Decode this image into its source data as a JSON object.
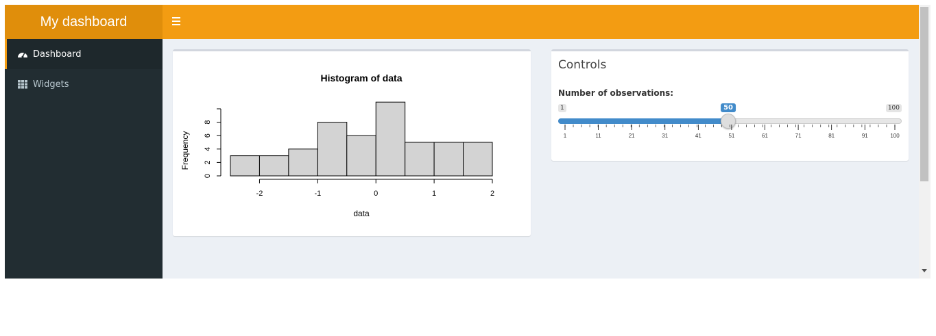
{
  "header": {
    "title": "My dashboard"
  },
  "sidebar": {
    "items": [
      {
        "label": "Dashboard",
        "icon": "dashboard-icon",
        "active": true
      },
      {
        "label": "Widgets",
        "icon": "grid-icon",
        "active": false
      }
    ]
  },
  "chart_data": {
    "type": "bar",
    "title": "Histogram of data",
    "xlabel": "data",
    "ylabel": "Frequency",
    "bins": [
      [
        -2.5,
        -2
      ],
      [
        -2,
        -1.5
      ],
      [
        -1.5,
        -1
      ],
      [
        -1,
        -0.5
      ],
      [
        -0.5,
        0
      ],
      [
        0,
        0.5
      ],
      [
        0.5,
        1
      ],
      [
        1,
        1.5
      ],
      [
        1.5,
        2
      ]
    ],
    "values": [
      3,
      3,
      4,
      8,
      6,
      11,
      5,
      5,
      5
    ],
    "xticks": [
      "-2",
      "-1",
      "0",
      "1",
      "2"
    ],
    "yticks": [
      "0",
      "2",
      "4",
      "6",
      "8"
    ],
    "xlim": [
      -2.5,
      2
    ],
    "ylim": [
      0,
      10
    ],
    "grid": false,
    "bar_color": "#d3d3d3"
  },
  "controls": {
    "title": "Controls",
    "label": "Number of observations:",
    "min": 1,
    "max": 100,
    "value": 50,
    "min_label": "1",
    "max_label": "100",
    "value_label": "50",
    "tick_labels": [
      "1",
      "11",
      "21",
      "31",
      "41",
      "51",
      "61",
      "71",
      "81",
      "91",
      "100"
    ],
    "accent_color": "#428bca"
  },
  "colors": {
    "header": "#f39c12",
    "logo": "#e08e0b",
    "sidebar": "#222d32"
  }
}
